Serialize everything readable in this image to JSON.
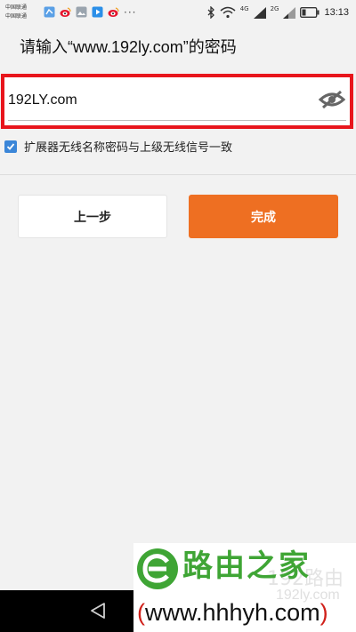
{
  "status_bar": {
    "carrier_1": "中国联通",
    "carrier_2": "中国联通",
    "network_4g": "4G",
    "network_2g": "2G",
    "time": "13:13",
    "notification_icons": [
      "stitch-icon",
      "weibo-icon",
      "gallery-icon",
      "video-play-icon",
      "weibo-icon"
    ]
  },
  "page": {
    "title": "请输入“www.192ly.com”的密码"
  },
  "password_field": {
    "value": "192LY.com",
    "highlight_color": "#e8151c"
  },
  "sync_option": {
    "label": "扩展器无线名称密码与上级无线信号一致",
    "checked": true
  },
  "buttons": {
    "prev_label": "上一步",
    "done_label": "完成",
    "accent_color": "#ee6f22"
  },
  "watermark": {
    "title": "路由之家",
    "url_open": "(",
    "url": "www.hhhyh.com",
    "url_close": ")",
    "ghost_text": "192路由",
    "ghost_url": "192ly.com"
  }
}
